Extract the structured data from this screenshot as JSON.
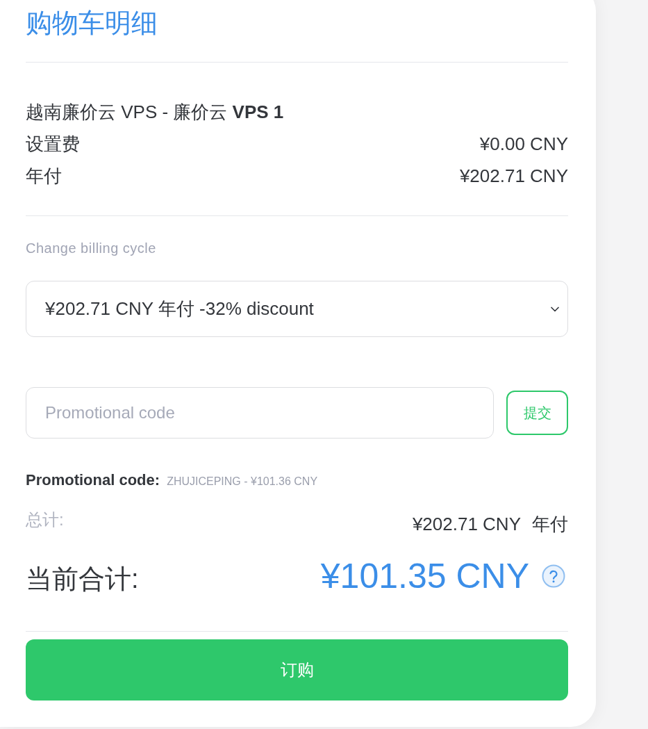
{
  "title": "购物车明细",
  "product": {
    "name": "越南廉价云 VPS - 廉价云 **VPS 1**"
  },
  "line_items": [
    {
      "label": "设置费",
      "amount": "¥0.00 CNY"
    },
    {
      "label": "年付",
      "amount": "¥202.71 CNY"
    }
  ],
  "billing_cycle": {
    "label": "Change billing cycle",
    "value": "¥202.71 CNY 年付 -32% discount"
  },
  "promo": {
    "placeholder": "Promotional code",
    "submit_button": "提交",
    "applied_label": "Promotional code:",
    "applied_value": "ZHUJICEPING - ¥101.36 CNY"
  },
  "totals": {
    "subtotal_label": "总计:",
    "subtotal_amount": "¥202.71 CNY",
    "subtotal_cycle": "年付",
    "current_label": "当前合计:",
    "current_amount": "¥101.35 CNY"
  },
  "order_button": "订购"
}
